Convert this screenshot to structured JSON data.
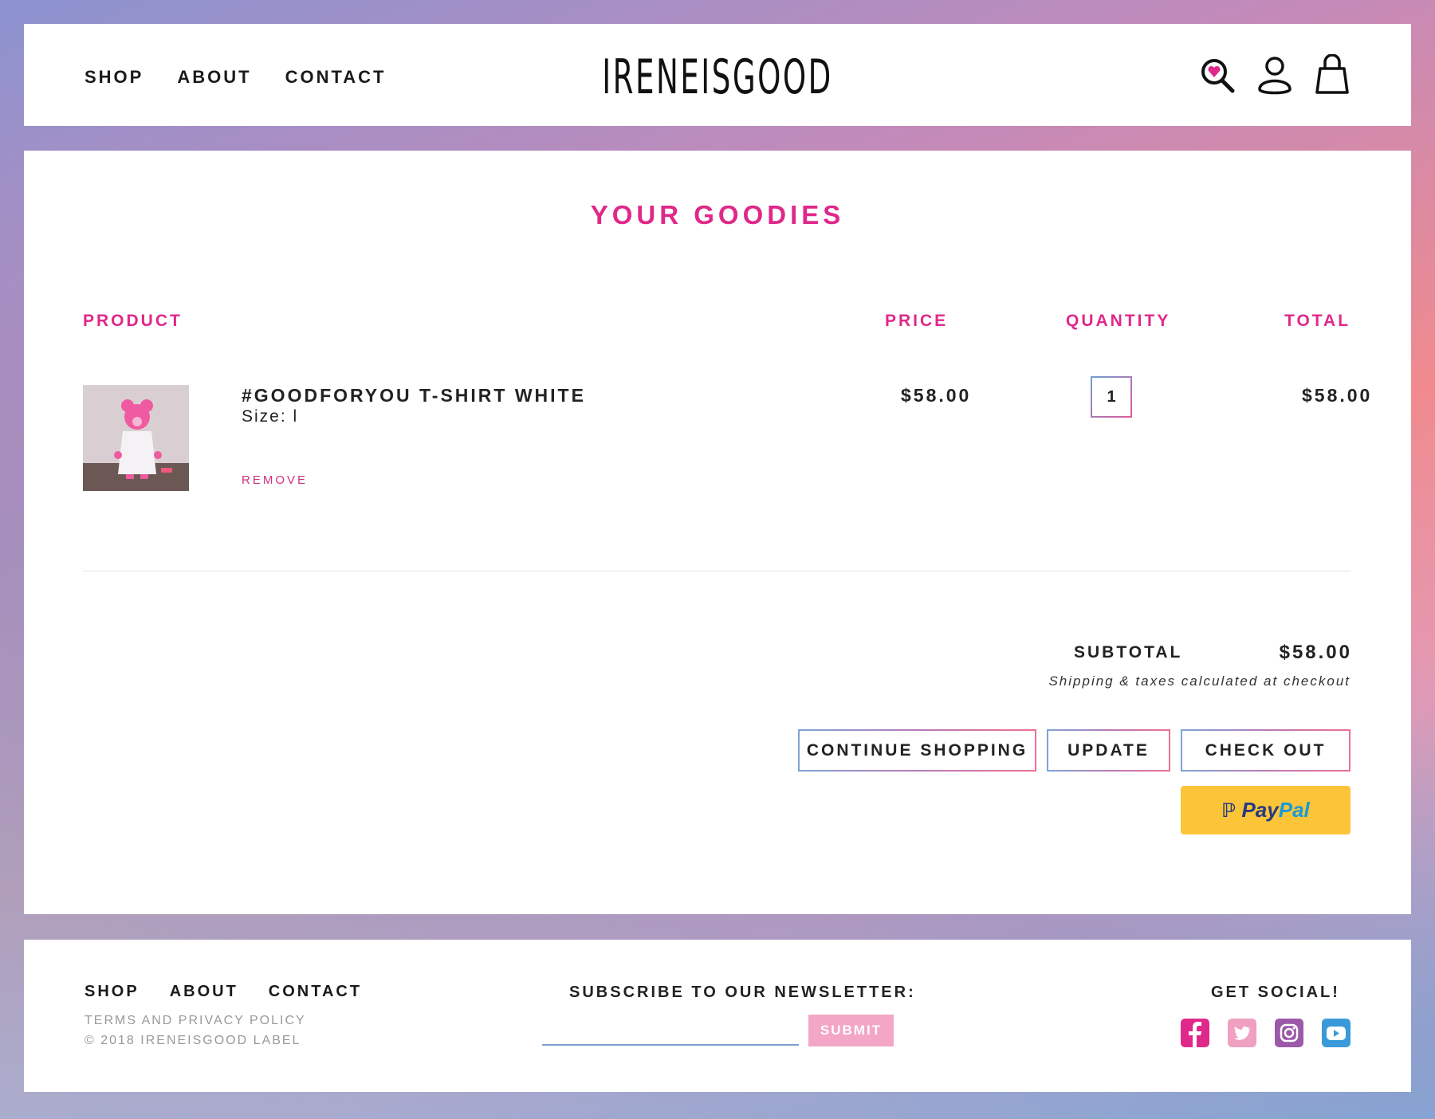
{
  "header": {
    "nav": [
      "SHOP",
      "ABOUT",
      "CONTACT"
    ],
    "logo": "IRENEISGOOD",
    "icons": [
      "search-heart-icon",
      "user-icon",
      "shopping-bag-icon"
    ]
  },
  "cart": {
    "title": "YOUR GOODIES",
    "columns": {
      "product": "PRODUCT",
      "price": "PRICE",
      "quantity": "QUANTITY",
      "total": "TOTAL"
    },
    "items": [
      {
        "name": "#GOODFORYOU T-SHIRT WHITE",
        "size": "Size: l",
        "remove_label": "REMOVE",
        "price": "$58.00",
        "quantity": "1",
        "total": "$58.00"
      }
    ],
    "subtotal_label": "SUBTOTAL",
    "subtotal_value": "$58.00",
    "shipping_note": "Shipping & taxes calculated at checkout",
    "buttons": {
      "continue": "CONTINUE SHOPPING",
      "update": "UPDATE",
      "checkout": "CHECK OUT"
    },
    "paypal": {
      "part1": "Pay",
      "part2": "Pal"
    }
  },
  "footer": {
    "nav": [
      "SHOP",
      "ABOUT",
      "CONTACT"
    ],
    "terms": "TERMS AND PRIVACY POLICY",
    "copyright": "© 2018 IRENEISGOOD LABEL",
    "newsletter_label": "SUBSCRIBE TO OUR NEWSLETTER:",
    "newsletter_value": "",
    "submit_label": "SUBMIT",
    "social_label": "GET SOCIAL!",
    "social": [
      {
        "icon": "facebook-icon",
        "color": "#e0288a"
      },
      {
        "icon": "twitter-icon",
        "color": "#f0a0c0"
      },
      {
        "icon": "instagram-icon",
        "color": "#9b59a8"
      },
      {
        "icon": "youtube-icon",
        "color": "#3a9ad9"
      }
    ]
  },
  "colors": {
    "accent": "#e0288a",
    "paypal": "#fcc439"
  }
}
